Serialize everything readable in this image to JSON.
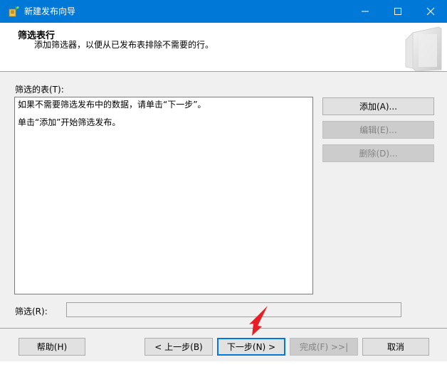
{
  "window": {
    "title": "新建发布向导",
    "controls": {
      "minimize_icon": "minimize-icon",
      "maximize_icon": "maximize-icon",
      "close_icon": "close-icon"
    }
  },
  "header": {
    "title": "筛选表行",
    "subtitle": "添加筛选器，以便从已发布表排除不需要的行。"
  },
  "filtered_tables": {
    "label": "筛选的表(T):",
    "lines": [
      "如果不需要筛选发布中的数据，请单击“下一步”。",
      "单击“添加”开始筛选发布。"
    ]
  },
  "side_buttons": {
    "add": "添加(A)...",
    "edit": "编辑(E)...",
    "delete": "删除(D)..."
  },
  "filter": {
    "label": "筛选(R):",
    "value": ""
  },
  "footer_buttons": {
    "help": "帮助(H)",
    "back": "< 上一步(B)",
    "next": "下一步(N) >",
    "finish": "完成(F) >>|",
    "cancel": "取消"
  },
  "colors": {
    "titlebar": "#0078d7",
    "annotation_arrow": "#e81e25"
  }
}
